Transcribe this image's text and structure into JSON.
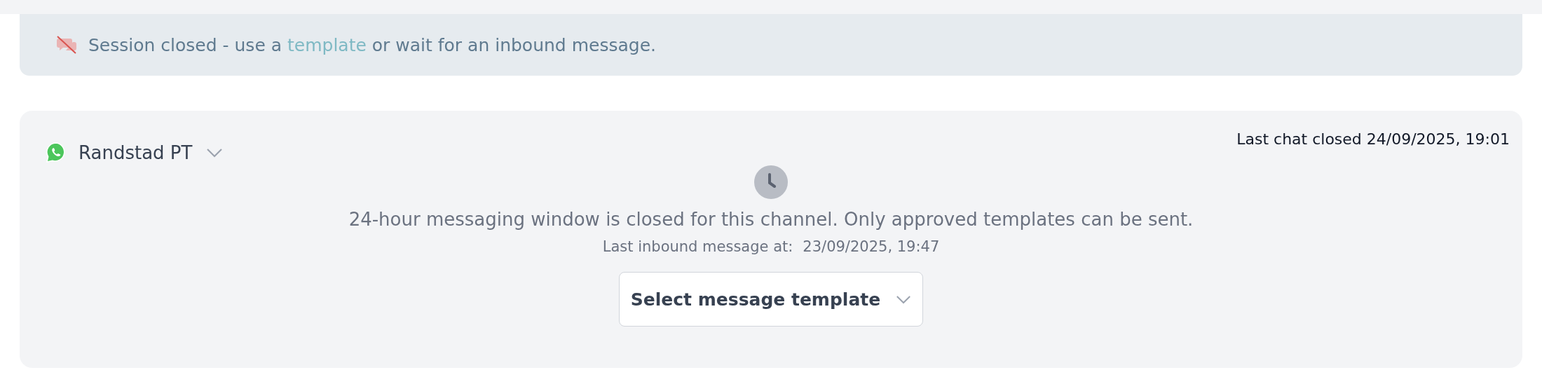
{
  "banner": {
    "text_before": "Session closed - use a",
    "link": "template",
    "text_after": "or wait for an inbound message."
  },
  "channel": {
    "name": "Randstad PT",
    "last_closed": "Last chat closed 24/09/2025, 19:01",
    "notice": "24-hour messaging window is closed for this channel. Only approved templates can be sent.",
    "last_inbound_label": "Last inbound message at:",
    "last_inbound_time": "23/09/2025, 19:47",
    "template_select": {
      "placeholder": "Select message template"
    }
  }
}
